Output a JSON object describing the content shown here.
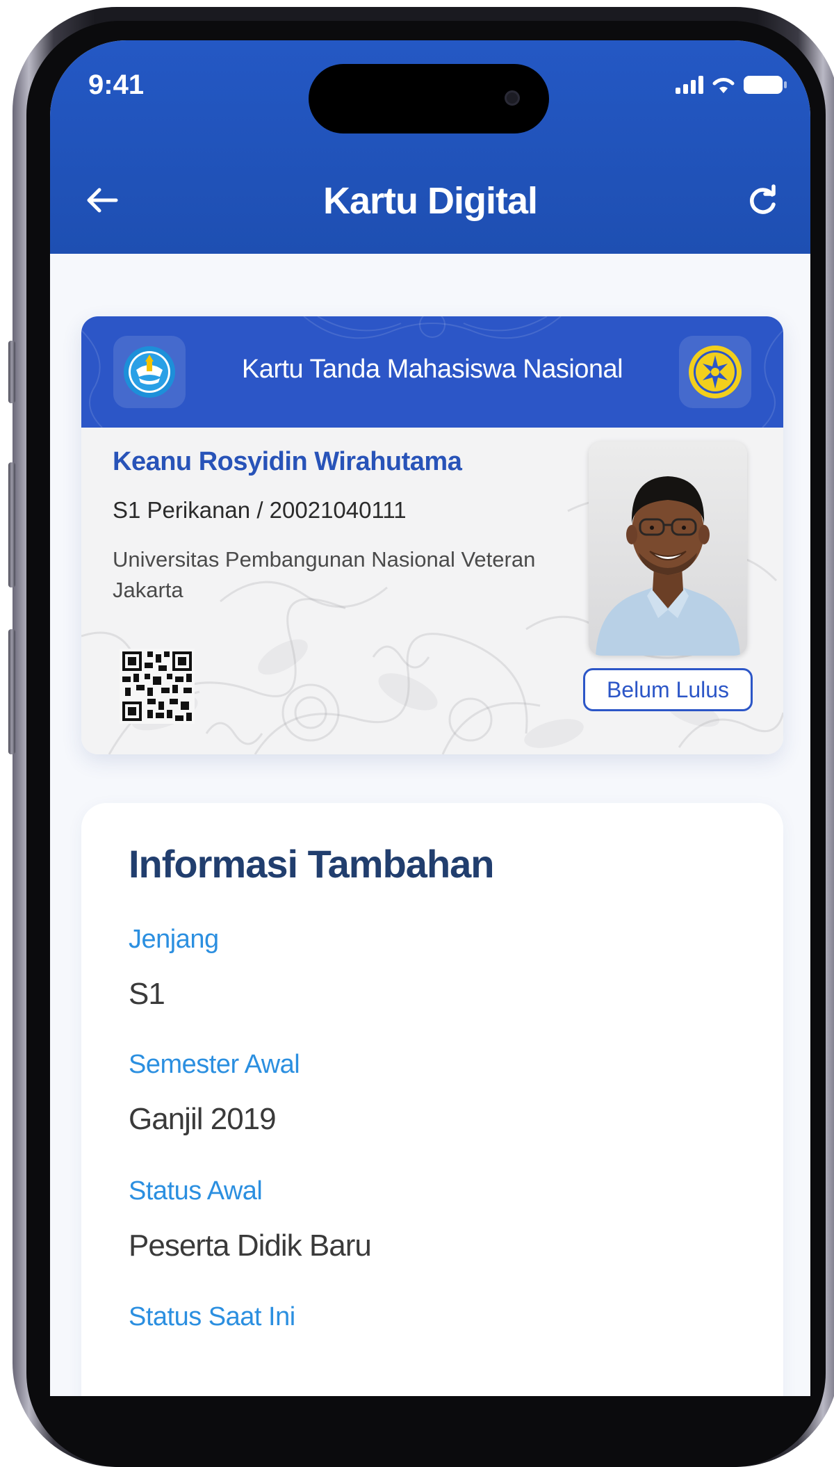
{
  "status_bar": {
    "time": "9:41"
  },
  "header": {
    "title": "Kartu Digital",
    "back_icon": "arrow-left-icon",
    "refresh_icon": "refresh-icon",
    "background": "#2458c4"
  },
  "card": {
    "title": "Kartu Tanda Mahasiswa Nasional",
    "student_name": "Keanu Rosyidin Wirahutama",
    "program": "S1 Perikanan",
    "separator": "/",
    "student_id": "20021040111",
    "university": "Universitas Pembangunan Nasional Veteran Jakarta",
    "status_badge": "Belum Lulus",
    "accent_color": "#2c56c7"
  },
  "info": {
    "title": "Informasi Tambahan",
    "fields": [
      {
        "label": "Jenjang",
        "value": "S1"
      },
      {
        "label": "Semester Awal",
        "value": "Ganjil 2019"
      },
      {
        "label": "Status Awal",
        "value": "Peserta Didik Baru"
      },
      {
        "label": "Status Saat Ini",
        "value": ""
      }
    ]
  }
}
